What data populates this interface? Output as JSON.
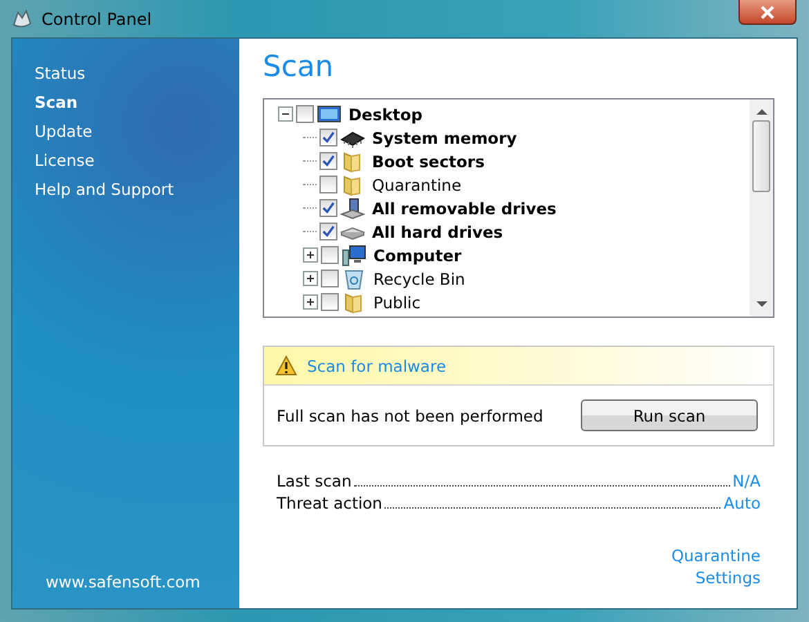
{
  "window": {
    "title": "Control Panel"
  },
  "sidebar": {
    "items": [
      {
        "label": "Status",
        "selected": false
      },
      {
        "label": "Scan",
        "selected": true
      },
      {
        "label": "Update",
        "selected": false
      },
      {
        "label": "License",
        "selected": false
      },
      {
        "label": "Help and Support",
        "selected": false
      }
    ],
    "footer": "www.safensoft.com"
  },
  "heading": "Scan",
  "tree": [
    {
      "label": "Desktop",
      "kind": "desktop",
      "checked": false,
      "bold": true,
      "expanded": true,
      "children": [
        {
          "label": "System memory",
          "kind": "chip",
          "checked": true,
          "bold": true
        },
        {
          "label": "Boot sectors",
          "kind": "folder",
          "checked": true,
          "bold": true
        },
        {
          "label": "Quarantine",
          "kind": "folder",
          "checked": false,
          "bold": false
        },
        {
          "label": "All removable drives",
          "kind": "removable",
          "checked": true,
          "bold": true
        },
        {
          "label": "All hard drives",
          "kind": "harddisk",
          "checked": true,
          "bold": true
        },
        {
          "label": "Computer",
          "kind": "computer",
          "checked": false,
          "bold": true,
          "expanded": false
        },
        {
          "label": "Recycle Bin",
          "kind": "recycle",
          "checked": false,
          "bold": false,
          "expanded": false
        },
        {
          "label": "Public",
          "kind": "folder",
          "checked": false,
          "bold": false,
          "expanded": false
        }
      ]
    }
  ],
  "alert": {
    "title": "Scan for malware",
    "message": "Full scan has not been performed",
    "button": "Run scan"
  },
  "info": [
    {
      "label": "Last scan",
      "value": "N/A"
    },
    {
      "label": "Threat action",
      "value": "Auto"
    }
  ],
  "links": [
    "Quarantine",
    "Settings"
  ]
}
